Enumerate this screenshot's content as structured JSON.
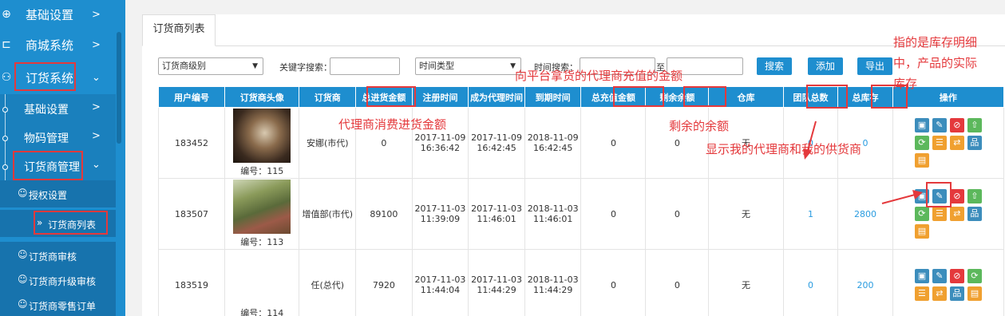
{
  "sidebar": {
    "items": [
      {
        "label": "基础设置",
        "icon": "globe-icon",
        "arrow": ">"
      },
      {
        "label": "商城系统",
        "icon": "cart-icon",
        "arrow": ">"
      },
      {
        "label": "订货系统",
        "icon": "network-icon",
        "arrow": "⌄"
      }
    ],
    "subitems": [
      {
        "label": "基础设置",
        "arrow": ">"
      },
      {
        "label": "物码管理",
        "arrow": ">"
      },
      {
        "label": "订货商管理",
        "arrow": "⌄"
      }
    ],
    "leaves": [
      {
        "label": "授权设置"
      },
      {
        "label": "订货商列表"
      },
      {
        "label": "订货商审核"
      },
      {
        "label": "订货商升级审核"
      },
      {
        "label": "订货商零售订单"
      }
    ]
  },
  "tab": {
    "label": "订货商列表"
  },
  "filters": {
    "level_select": "订货商级别",
    "keyword_label": "关键字搜索：",
    "time_type_select": "时间类型",
    "time_search_label": "时间搜索：",
    "to_label": "至",
    "search_button": "搜索",
    "add_button": "添加",
    "export_button": "导出"
  },
  "table": {
    "headers": [
      "用户编号",
      "订货商头像",
      "订货商",
      "总进货金额",
      "注册时间",
      "成为代理时间",
      "到期时间",
      "总充值金额",
      "剩余余额",
      "仓库",
      "团队总数",
      "总库存",
      "操作"
    ],
    "rows": [
      {
        "id": "183452",
        "code": "编号：115",
        "name": "安娜(市代)",
        "purchase": "0",
        "reg": [
          "2017-11-09",
          "16:36:42"
        ],
        "agent": [
          "2017-11-09",
          "16:42:45"
        ],
        "expire": [
          "2018-11-09",
          "16:42:45"
        ],
        "recharge": "0",
        "balance": "0",
        "warehouse": "无",
        "team": "0",
        "stock": "0"
      },
      {
        "id": "183507",
        "code": "编号：113",
        "name": "增值部(市代)",
        "purchase": "89100",
        "reg": [
          "2017-11-03",
          "11:39:09"
        ],
        "agent": [
          "2017-11-03",
          "11:46:01"
        ],
        "expire": [
          "2018-11-03",
          "11:46:01"
        ],
        "recharge": "0",
        "balance": "0",
        "warehouse": "无",
        "team": "1",
        "stock": "2800"
      },
      {
        "id": "183519",
        "code": "编号：114",
        "name": "任(总代)",
        "purchase": "7920",
        "reg": [
          "2017-11-03",
          "11:44:04"
        ],
        "agent": [
          "2017-11-03",
          "11:44:29"
        ],
        "expire": [
          "2018-11-03",
          "11:44:29"
        ],
        "recharge": "0",
        "balance": "0",
        "warehouse": "无",
        "team": "0",
        "stock": "200"
      }
    ]
  },
  "annotations": {
    "recharge_note": "向平台拿货的代理商充值的金额",
    "purchase_note": "代理商消费进货金额",
    "balance_note": "剩余的余额",
    "team_note": "显示我的代理商和我的供货商",
    "stock_note_1": "指的是库存明细",
    "stock_note_2": "中，产品的实际",
    "stock_note_3": "库存"
  },
  "colors": {
    "primary": "#1e8ecf",
    "annotation": "#e4393c",
    "link": "#2a9ce0"
  }
}
